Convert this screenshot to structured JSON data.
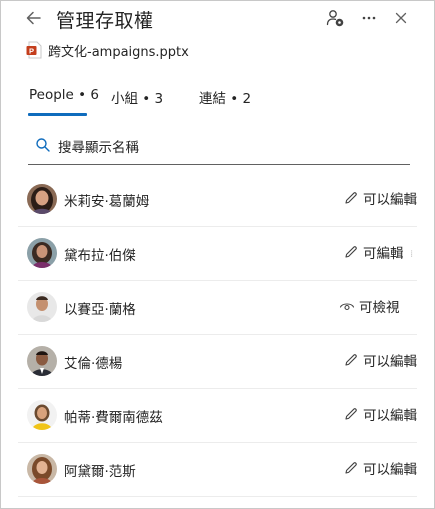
{
  "header": {
    "title": "管理存取權",
    "back_icon": "arrow-left-icon",
    "share_settings_icon": "person-settings-icon",
    "more_icon": "more-horizontal-icon",
    "close_icon": "close-icon"
  },
  "file": {
    "name": "跨文化-ampaigns.pptx",
    "icon": "powerpoint-file-icon",
    "icon_color": "#c43e1c"
  },
  "tabs": [
    {
      "label": "People • 6",
      "selected": true
    },
    {
      "label": "小組 • 3",
      "selected": false
    },
    {
      "label": "連結 • 2",
      "selected": false
    }
  ],
  "search": {
    "placeholder": "搜尋顯示名稱"
  },
  "people": [
    {
      "name": "米莉安·葛蘭姆",
      "permission": "可以編輯",
      "permission_icon": "pencil-icon"
    },
    {
      "name": "黛布拉·伯傑",
      "permission": "可編輯",
      "permission_icon": "pencil-icon"
    },
    {
      "name": "以賽亞·蘭格",
      "permission": "可檢視",
      "permission_icon": "eye-icon"
    },
    {
      "name": "艾倫·德楊",
      "permission": "可以編輯",
      "permission_icon": "pencil-icon"
    },
    {
      "name": "帕蒂·費爾南德茲",
      "permission": "可以編輯",
      "permission_icon": "pencil-icon"
    },
    {
      "name": "阿黛爾·范斯",
      "permission": "可以編輯",
      "permission_icon": "pencil-icon"
    }
  ],
  "colors": {
    "accent": "#0f6cbd",
    "text": "#242424",
    "divider": "#ececec",
    "border": "#c8c8c8"
  }
}
